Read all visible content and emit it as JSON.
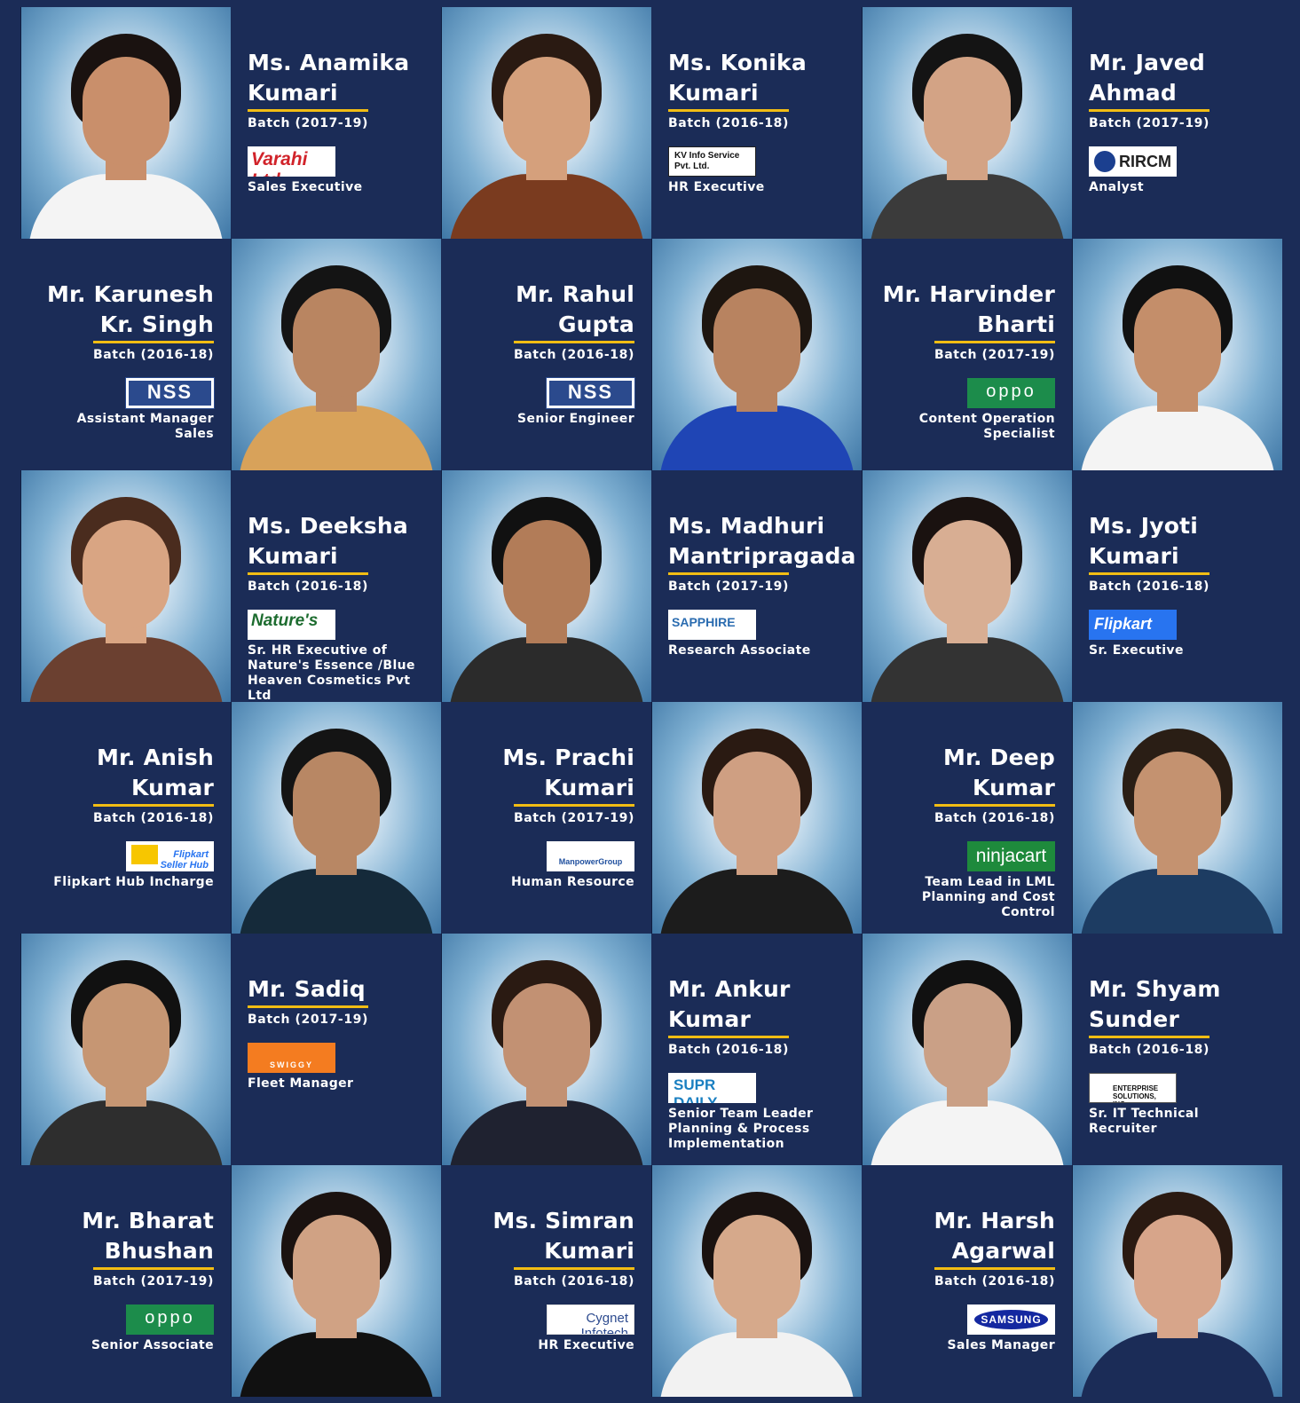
{
  "profiles": [
    {
      "name": "Ms. Anamika Kumari",
      "batch": "Batch (2017-19)",
      "logo": "Varahi Ltd.",
      "role": "Sales Executive"
    },
    {
      "name": "Ms. Konika Kumari",
      "batch": "Batch (2016-18)",
      "logo": "KV Info Service Pvt. Ltd.",
      "role": "HR Executive"
    },
    {
      "name": "Mr. Javed Ahmad",
      "batch": "Batch (2017-19)",
      "logo": "RIRCM",
      "role": "Analyst"
    },
    {
      "name": "Mr. Karunesh Kr. Singh",
      "batch": "Batch (2016-18)",
      "logo": "NSS",
      "role": "Assistant Manager Sales"
    },
    {
      "name": "Mr. Rahul Gupta",
      "batch": "Batch (2016-18)",
      "logo": "NSS",
      "role": "Senior Engineer"
    },
    {
      "name": "Mr. Harvinder Bharti",
      "batch": "Batch (2017-19)",
      "logo": "oppo",
      "role": "Content Operation Specialist"
    },
    {
      "name": "Ms. Deeksha Kumari",
      "batch": "Batch (2016-18)",
      "logo": "Nature's",
      "role": "Sr. HR Executive of Nature's Essence /Blue Heaven Cosmetics Pvt Ltd"
    },
    {
      "name": "Ms. Madhuri Mantripragada",
      "batch": "Batch (2017-19)",
      "logo": "SAPPHIRE",
      "role": "Research Associate"
    },
    {
      "name": "Ms. Jyoti Kumari",
      "batch": "Batch (2016-18)",
      "logo": "Flipkart",
      "role": "Sr. Executive"
    },
    {
      "name": "Mr. Anish Kumar",
      "batch": "Batch (2016-18)",
      "logo": "Flipkart Seller Hub",
      "role": "Flipkart Hub Incharge"
    },
    {
      "name": "Ms. Prachi Kumari",
      "batch": "Batch (2017-19)",
      "logo": "ManpowerGroup",
      "role": "Human Resource"
    },
    {
      "name": "Mr. Deep Kumar",
      "batch": "Batch (2016-18)",
      "logo": "ninjacart",
      "role": "Team Lead in LML Planning and Cost Control"
    },
    {
      "name": "Mr. Sadiq",
      "batch": "Batch (2017-19)",
      "logo": "SWIGGY",
      "role": "Fleet Manager"
    },
    {
      "name": "Mr. Ankur Kumar",
      "batch": "Batch (2016-18)",
      "logo": "SUPR DAILY",
      "role": "Senior Team Leader Planning & Process Implementation"
    },
    {
      "name": "Mr. Shyam Sunder",
      "batch": "Batch (2016-18)",
      "logo": "ENTERPRISE SOLUTIONS, INC.",
      "role": "Sr. IT Technical Recruiter"
    },
    {
      "name": "Mr. Bharat Bhushan",
      "batch": "Batch (2017-19)",
      "logo": "oppo",
      "role": "Senior Associate"
    },
    {
      "name": "Ms. Simran Kumari",
      "batch": "Batch (2016-18)",
      "logo": "Cygnet Infotech",
      "role": "HR Executive"
    },
    {
      "name": "Mr. Harsh Agarwal",
      "batch": "Batch (2016-18)",
      "logo": "SAMSUNG",
      "role": "Sales Manager"
    }
  ],
  "colors": {
    "background": "#1b2c57",
    "accent_rule": "#f2bd13",
    "text": "#ffffff"
  }
}
